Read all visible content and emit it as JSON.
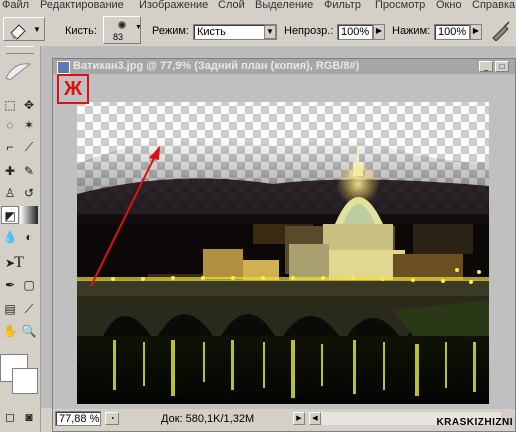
{
  "menu": [
    "Файл",
    "Редактирование",
    "Изображение",
    "Слой",
    "Выделение",
    "Фильтр",
    "Просмотр",
    "Окно",
    "Справка"
  ],
  "options": {
    "brush_label": "Кисть:",
    "brush_size": "83",
    "mode_label": "Режим:",
    "mode_value": "Кисть",
    "opacity_label": "Непрозр.:",
    "opacity_value": "100%",
    "pressure_label": "Нажим:",
    "pressure_value": "100%"
  },
  "document": {
    "title": "Ватикан3.jpg @ 77,9% (Задний план (копия), RGB/8#)",
    "annotation_letter": "Ж",
    "zoom": "77,88 %",
    "doc_info": "Док: 580,1K/1,32M"
  },
  "toolbox": {
    "text_tool_glyph": "T"
  },
  "watermark": "KRASKIZHIZNI",
  "colors": {
    "annotation_red": "#e01010",
    "ui_gray": "#d4d0c8",
    "workspace_gray": "#bcbcbc",
    "bridge_lights": "#f0e030"
  },
  "icons": [
    "eraser-icon",
    "brush-preview-icon",
    "airbrush-icon",
    "marquee-icon",
    "lasso-icon",
    "magic-wand-icon",
    "crop-icon",
    "slice-icon",
    "healing-icon",
    "brush-tool-icon",
    "stamp-icon",
    "history-brush-icon",
    "eraser-tool-icon",
    "gradient-icon",
    "blur-icon",
    "dodge-icon",
    "path-select-icon",
    "text-icon",
    "pen-icon",
    "shape-icon",
    "notes-icon",
    "eyedropper-icon",
    "hand-icon",
    "zoom-icon",
    "color-swatch-icon",
    "mask-mode-icon"
  ]
}
